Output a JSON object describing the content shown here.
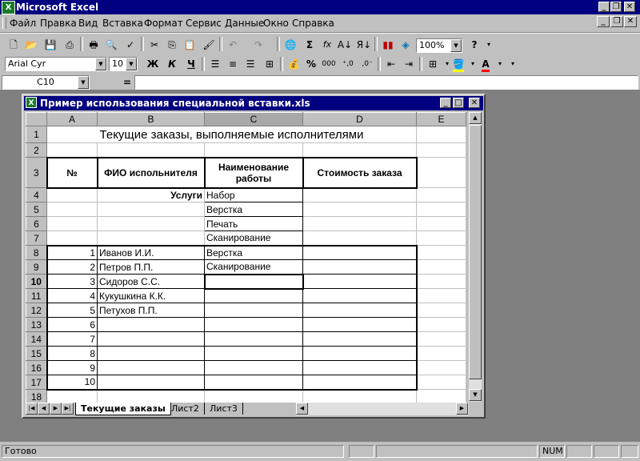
{
  "app": {
    "title": "Microsoft Excel",
    "icon_glyph": "X"
  },
  "menu": [
    "Файл",
    "Правка",
    "Вид",
    "Вставка",
    "Формат",
    "Сервис",
    "Данные",
    "Окно",
    "Справка"
  ],
  "toolbar": {
    "zoom": "100%",
    "sum": "Σ",
    "fx": "fx"
  },
  "format_toolbar": {
    "font": "Arial Cyr",
    "size": "10",
    "bold": "Ж",
    "italic": "К",
    "underline": "Ч",
    "percent": "%",
    "thousands": "000"
  },
  "formula_bar": {
    "cell_ref": "C10",
    "equals": "=",
    "value": ""
  },
  "workbook": {
    "title": "Пример использования специальной вставки.xls",
    "icon_glyph": "X"
  },
  "sheet": {
    "columns": [
      "A",
      "B",
      "C",
      "D",
      "E"
    ],
    "rows": [
      {
        "n": "1",
        "a": "",
        "b": "",
        "c": "",
        "d": "",
        "title": "Текущие заказы, выполняемые исполнителями"
      },
      {
        "n": "2",
        "a": "",
        "b": "",
        "c": "",
        "d": ""
      },
      {
        "n": "3",
        "a": "№",
        "b": "ФИО испольнителя",
        "c": "Наименование работы",
        "d": "Стоимость заказа"
      },
      {
        "n": "4",
        "a": "",
        "b": "Услуги",
        "c": "Набор",
        "d": ""
      },
      {
        "n": "5",
        "a": "",
        "b": "",
        "c": "Верстка",
        "d": ""
      },
      {
        "n": "6",
        "a": "",
        "b": "",
        "c": "Печать",
        "d": ""
      },
      {
        "n": "7",
        "a": "",
        "b": "",
        "c": "Сканирование",
        "d": ""
      },
      {
        "n": "8",
        "a": "1",
        "b": "Иванов И.И.",
        "c": "Верстка",
        "d": ""
      },
      {
        "n": "9",
        "a": "2",
        "b": "Петров П.П.",
        "c": "Сканирование",
        "d": ""
      },
      {
        "n": "10",
        "a": "3",
        "b": "Сидоров С.С.",
        "c": "",
        "d": ""
      },
      {
        "n": "11",
        "a": "4",
        "b": "Кукушкина К.К.",
        "c": "",
        "d": ""
      },
      {
        "n": "12",
        "a": "5",
        "b": "Петухов П.П.",
        "c": "",
        "d": ""
      },
      {
        "n": "13",
        "a": "6",
        "b": "",
        "c": "",
        "d": ""
      },
      {
        "n": "14",
        "a": "7",
        "b": "",
        "c": "",
        "d": ""
      },
      {
        "n": "15",
        "a": "8",
        "b": "",
        "c": "",
        "d": ""
      },
      {
        "n": "16",
        "a": "9",
        "b": "",
        "c": "",
        "d": ""
      },
      {
        "n": "17",
        "a": "10",
        "b": "",
        "c": "",
        "d": ""
      },
      {
        "n": "18",
        "a": "",
        "b": "",
        "c": "",
        "d": ""
      }
    ],
    "active_row": "10",
    "tabs": [
      "Текущие заказы",
      "Лист2",
      "Лист3"
    ]
  },
  "status": {
    "text": "Готово",
    "num": "NUM"
  },
  "colors": {
    "titlebar": "#000080",
    "chrome": "#c0c0c0",
    "workspace": "#808080"
  }
}
